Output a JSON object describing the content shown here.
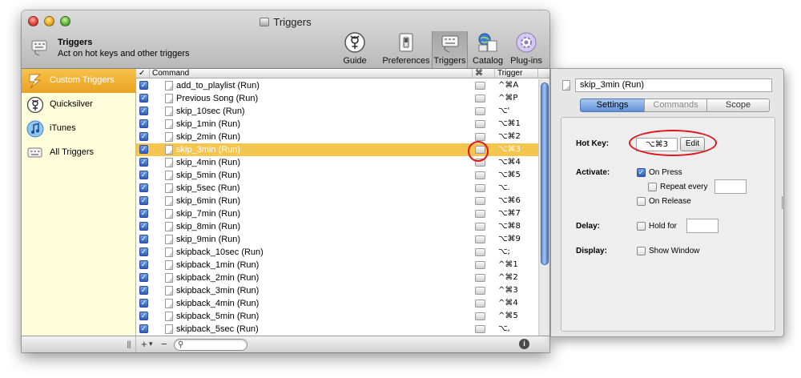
{
  "window": {
    "title": "Triggers",
    "header_title": "Triggers",
    "header_subtitle": "Act on hot keys and other triggers"
  },
  "toolbar": {
    "buttons": [
      {
        "label": "Guide",
        "icon": "quicksilver-logo-icon"
      },
      {
        "label": "Preferences",
        "icon": "switch-icon"
      },
      {
        "label": "Triggers",
        "icon": "keyboard-icon",
        "selected": true
      },
      {
        "label": "Catalog",
        "icon": "catalog-icon"
      },
      {
        "label": "Plug-ins",
        "icon": "plugin-gear-icon"
      }
    ]
  },
  "sidebar": {
    "items": [
      {
        "label": "Custom Triggers",
        "icon": "lightning-icon",
        "selected": true
      },
      {
        "label": "Quicksilver",
        "icon": "quicksilver-logo-icon"
      },
      {
        "label": "iTunes",
        "icon": "music-note-icon"
      },
      {
        "label": "All Triggers",
        "icon": "keyboard-icon"
      }
    ],
    "footer_grip": "|||"
  },
  "table": {
    "columns": [
      "✓",
      "Command",
      "⌘",
      "Trigger"
    ],
    "rows": [
      {
        "command": "add_to_playlist (Run)",
        "trigger": "^⌘A",
        "checked": true
      },
      {
        "command": "Previous Song (Run)",
        "trigger": "^⌘P",
        "checked": true
      },
      {
        "command": "skip_10sec (Run)",
        "trigger": "⌥'",
        "checked": true
      },
      {
        "command": "skip_1min (Run)",
        "trigger": "⌥⌘1",
        "checked": true
      },
      {
        "command": "skip_2min (Run)",
        "trigger": "⌥⌘2",
        "checked": true
      },
      {
        "command": "skip_3min (Run)",
        "trigger": "⌥⌘3",
        "checked": true,
        "selected": true
      },
      {
        "command": "skip_4min (Run)",
        "trigger": "⌥⌘4",
        "checked": true
      },
      {
        "command": "skip_5min (Run)",
        "trigger": "⌥⌘5",
        "checked": true
      },
      {
        "command": "skip_5sec (Run)",
        "trigger": "⌥.",
        "checked": true
      },
      {
        "command": "skip_6min (Run)",
        "trigger": "⌥⌘6",
        "checked": true
      },
      {
        "command": "skip_7min (Run)",
        "trigger": "⌥⌘7",
        "checked": true
      },
      {
        "command": "skip_8min (Run)",
        "trigger": "⌥⌘8",
        "checked": true
      },
      {
        "command": "skip_9min (Run)",
        "trigger": "⌥⌘9",
        "checked": true
      },
      {
        "command": "skipback_10sec (Run)",
        "trigger": "⌥;",
        "checked": true
      },
      {
        "command": "skipback_1min (Run)",
        "trigger": "^⌘1",
        "checked": true
      },
      {
        "command": "skipback_2min (Run)",
        "trigger": "^⌘2",
        "checked": true
      },
      {
        "command": "skipback_3min (Run)",
        "trigger": "^⌘3",
        "checked": true
      },
      {
        "command": "skipback_4min (Run)",
        "trigger": "^⌘4",
        "checked": true
      },
      {
        "command": "skipback_5min (Run)",
        "trigger": "^⌘5",
        "checked": true
      },
      {
        "command": "skipback_5sec (Run)",
        "trigger": "⌥,",
        "checked": true
      }
    ],
    "footer": {
      "add": "+",
      "add_menu": "▾",
      "remove": "−",
      "info": "i"
    }
  },
  "detail": {
    "name": "skip_3min (Run)",
    "tabs": [
      {
        "label": "Settings",
        "active": true
      },
      {
        "label": "Commands",
        "disabled": true
      },
      {
        "label": "Scope"
      }
    ],
    "hotkey_label": "Hot Key:",
    "hotkey_value": "⌥⌘3",
    "edit_label": "Edit",
    "activate_label": "Activate:",
    "on_press": "On Press",
    "repeat_every": "Repeat every",
    "on_release": "On Release",
    "delay_label": "Delay:",
    "hold_for": "Hold for",
    "display_label": "Display:",
    "show_window": "Show Window"
  },
  "colors": {
    "selection": "#f4c54f",
    "sidebar_bg": "#fffdda",
    "accent_blue": "#3b6fcf",
    "highlight_circle": "#e0141b"
  }
}
